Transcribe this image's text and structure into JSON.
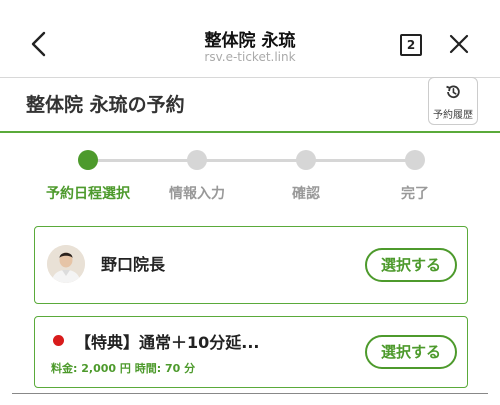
{
  "browser": {
    "title": "整体院 永琉",
    "url": "rsv.e-ticket.link",
    "tab_count": "2"
  },
  "page": {
    "title": "整体院 永琉の予約",
    "history_label": "予約履歴"
  },
  "steps": [
    {
      "label": "予約日程選択",
      "active": true
    },
    {
      "label": "情報入力",
      "active": false
    },
    {
      "label": "確認",
      "active": false
    },
    {
      "label": "完了",
      "active": false
    }
  ],
  "staff": {
    "name": "野口院長",
    "select_label": "選択する"
  },
  "menu": {
    "name": "【特典】通常＋10分延...",
    "price_label": "料金:",
    "price": "2,000 円",
    "time_label": "時間:",
    "time": "70 分",
    "select_label": "選択する"
  },
  "colors": {
    "accent": "#4d9a2c",
    "inactive": "#d6d6d6",
    "badge_red": "#d81b1b"
  }
}
